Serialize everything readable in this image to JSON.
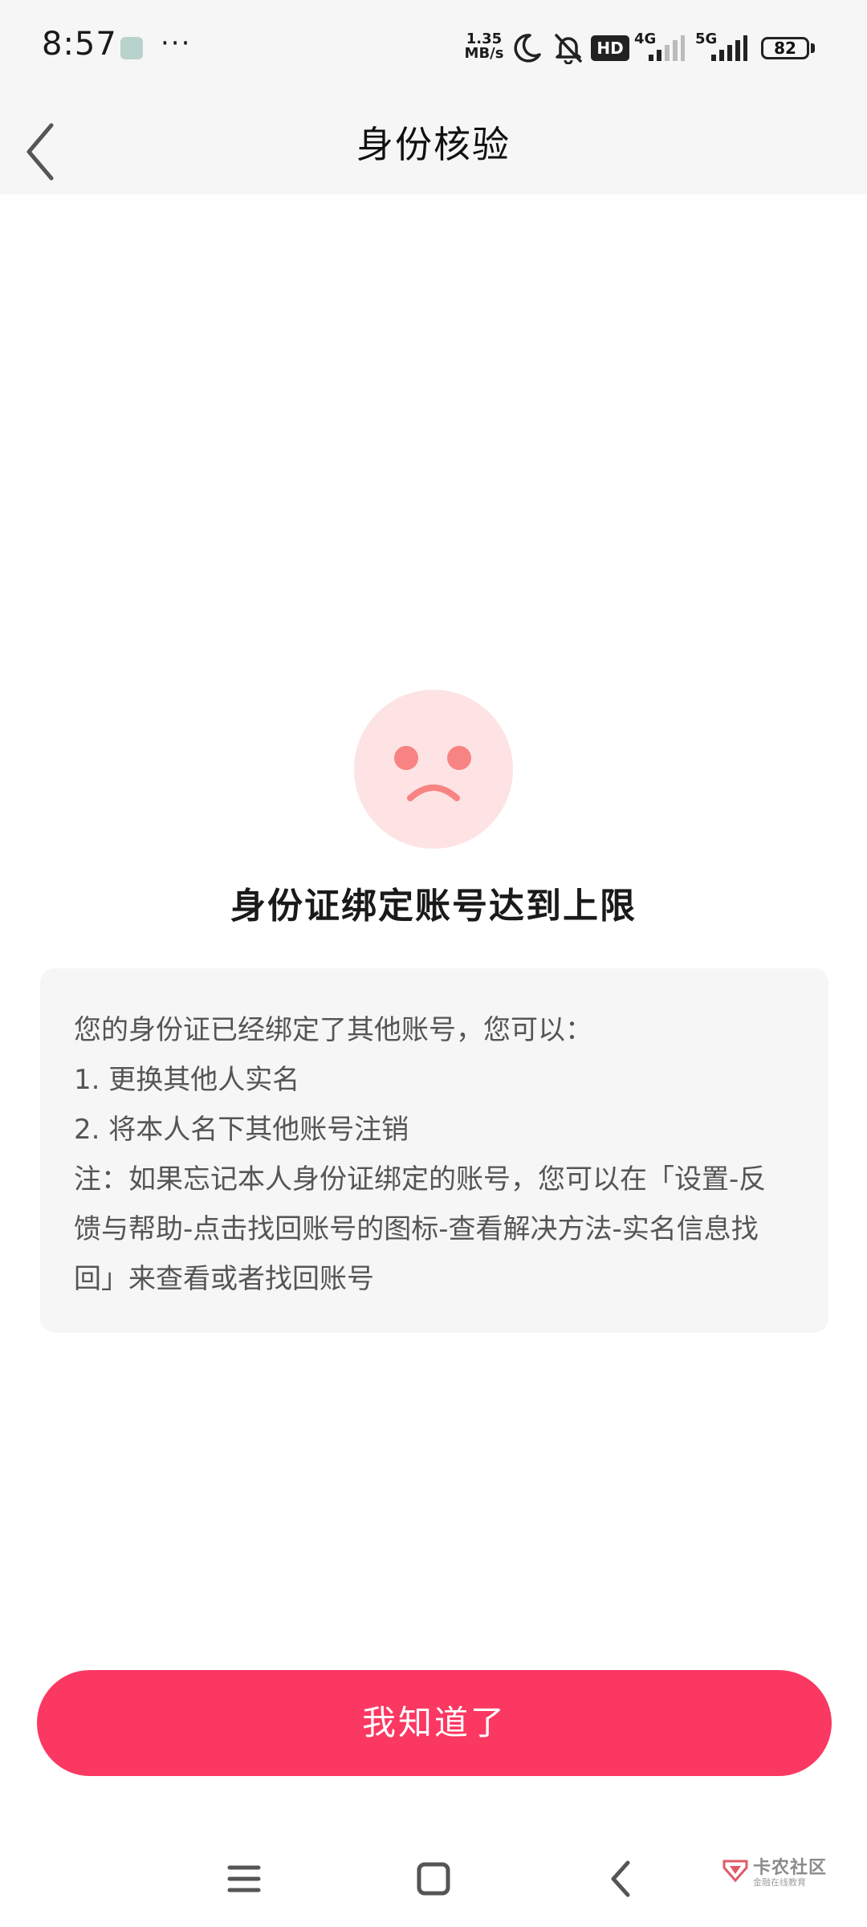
{
  "status_bar": {
    "time": "8:57",
    "dots": "···",
    "net_speed_value": "1.35",
    "net_speed_unit": "MB/s",
    "hd_label": "HD",
    "signal_1_label": "4G",
    "signal_2_label": "5G",
    "battery_level": "82"
  },
  "header": {
    "title": "身份核验"
  },
  "result": {
    "title": "身份证绑定账号达到上限",
    "icon": "sad-face-icon"
  },
  "info": {
    "lines": [
      "您的身份证已经绑定了其他账号，您可以：",
      "1. 更换其他人实名",
      "2. 将本人名下其他账号注销",
      "注：如果忘记本人身份证绑定的账号，您可以在「设置-反",
      "馈与帮助-点击找回账号的图标-查看解决方法-实名信息找",
      "回」来查看或者找回账号"
    ]
  },
  "actions": {
    "confirm_label": "我知道了"
  },
  "watermark": {
    "title": "卡农社区",
    "subtitle": "金融在线教育"
  },
  "colors": {
    "accent": "#fb3862",
    "face_bg": "#fde3e3",
    "face_features": "#f88383",
    "header_bg": "#f6f6f6",
    "card_bg": "#f6f6f6"
  }
}
